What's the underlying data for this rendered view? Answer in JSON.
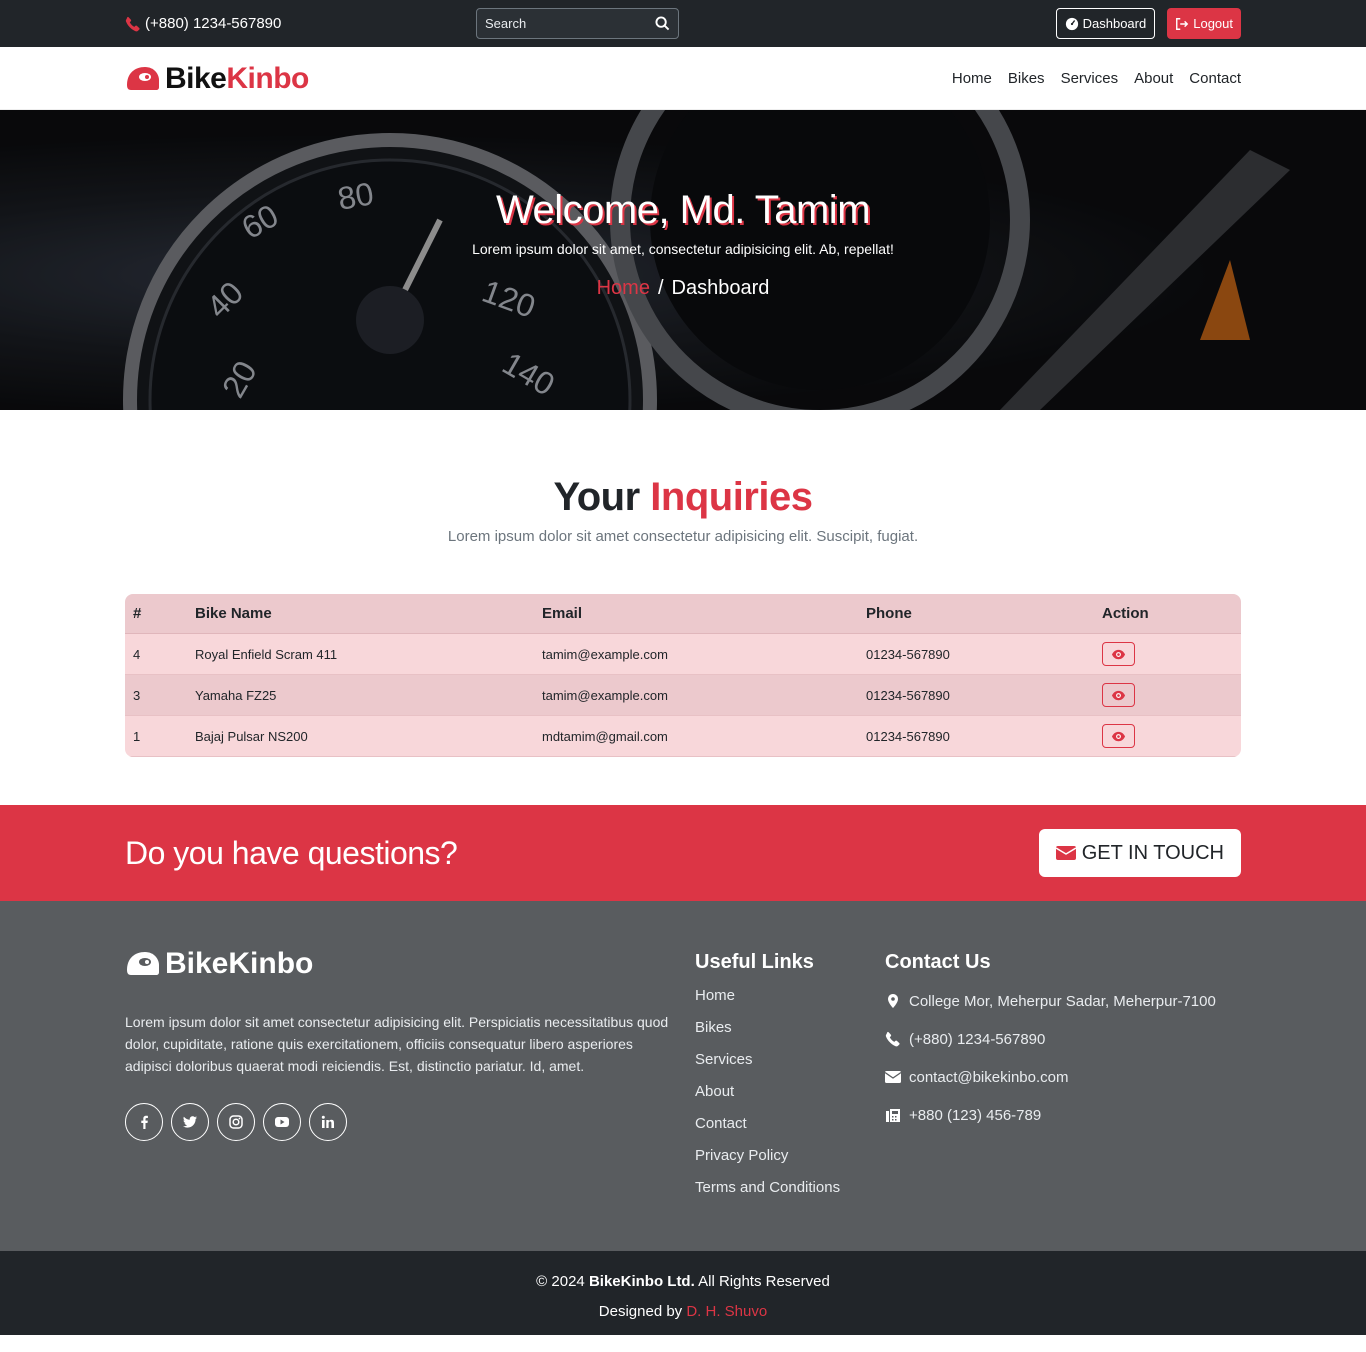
{
  "topbar": {
    "phone": "(+880) 1234-567890",
    "search_placeholder": "Search",
    "dashboard_label": "Dashboard",
    "logout_label": "Logout"
  },
  "brand": {
    "part1": "Bike",
    "part2": "Kinbo",
    "footer_name": "BikeKinbo"
  },
  "nav": [
    "Home",
    "Bikes",
    "Services",
    "About",
    "Contact"
  ],
  "hero": {
    "title": "Welcome, Md. Tamim",
    "subtitle": "Lorem ipsum dolor sit amet, consectetur adipisicing elit. Ab, repellat!",
    "crumb_home": "Home",
    "crumb_sep": "/",
    "crumb_current": "Dashboard"
  },
  "section": {
    "title_a": "Your",
    "title_b": "Inquiries",
    "subtitle": "Lorem ipsum dolor sit amet consectetur adipisicing elit. Suscipit, fugiat."
  },
  "table": {
    "headers": [
      "#",
      "Bike Name",
      "Email",
      "Phone",
      "Action"
    ],
    "rows": [
      {
        "id": "4",
        "bike": "Royal Enfield Scram 411",
        "email": "tamim@example.com",
        "phone": "01234-567890"
      },
      {
        "id": "3",
        "bike": "Yamaha FZ25",
        "email": "tamim@example.com",
        "phone": "01234-567890"
      },
      {
        "id": "1",
        "bike": "Bajaj Pulsar NS200",
        "email": "mdtamim@gmail.com",
        "phone": "01234-567890"
      }
    ]
  },
  "cta": {
    "title": "Do you have questions?",
    "button": "GET IN TOUCH"
  },
  "footer": {
    "description": "Lorem ipsum dolor sit amet consectetur adipisicing elit. Perspiciatis necessitatibus quod dolor, cupiditate, ratione quis exercitationem, officiis consequatur libero asperiores adipisci doloribus quaerat modi reiciendis. Est, distinctio pariatur. Id, amet.",
    "useful_links_title": "Useful Links",
    "useful_links": [
      "Home",
      "Bikes",
      "Services",
      "About",
      "Contact",
      "Privacy Policy",
      "Terms and Conditions"
    ],
    "contact_title": "Contact Us",
    "address": "College Mor, Meherpur Sadar, Meherpur-7100",
    "phone": "(+880) 1234-567890",
    "email": "contact@bikekinbo.com",
    "fax": "+880 (123) 456-789"
  },
  "bottom": {
    "copy_prefix": "© 2024",
    "company": "BikeKinbo Ltd.",
    "rights": "All Rights Reserved",
    "designed_by": "Designed by",
    "designer": "D. H. Shuvo"
  },
  "colors": {
    "accent": "#dc3545",
    "dark": "#212529",
    "footer_bg": "#595c5f"
  }
}
